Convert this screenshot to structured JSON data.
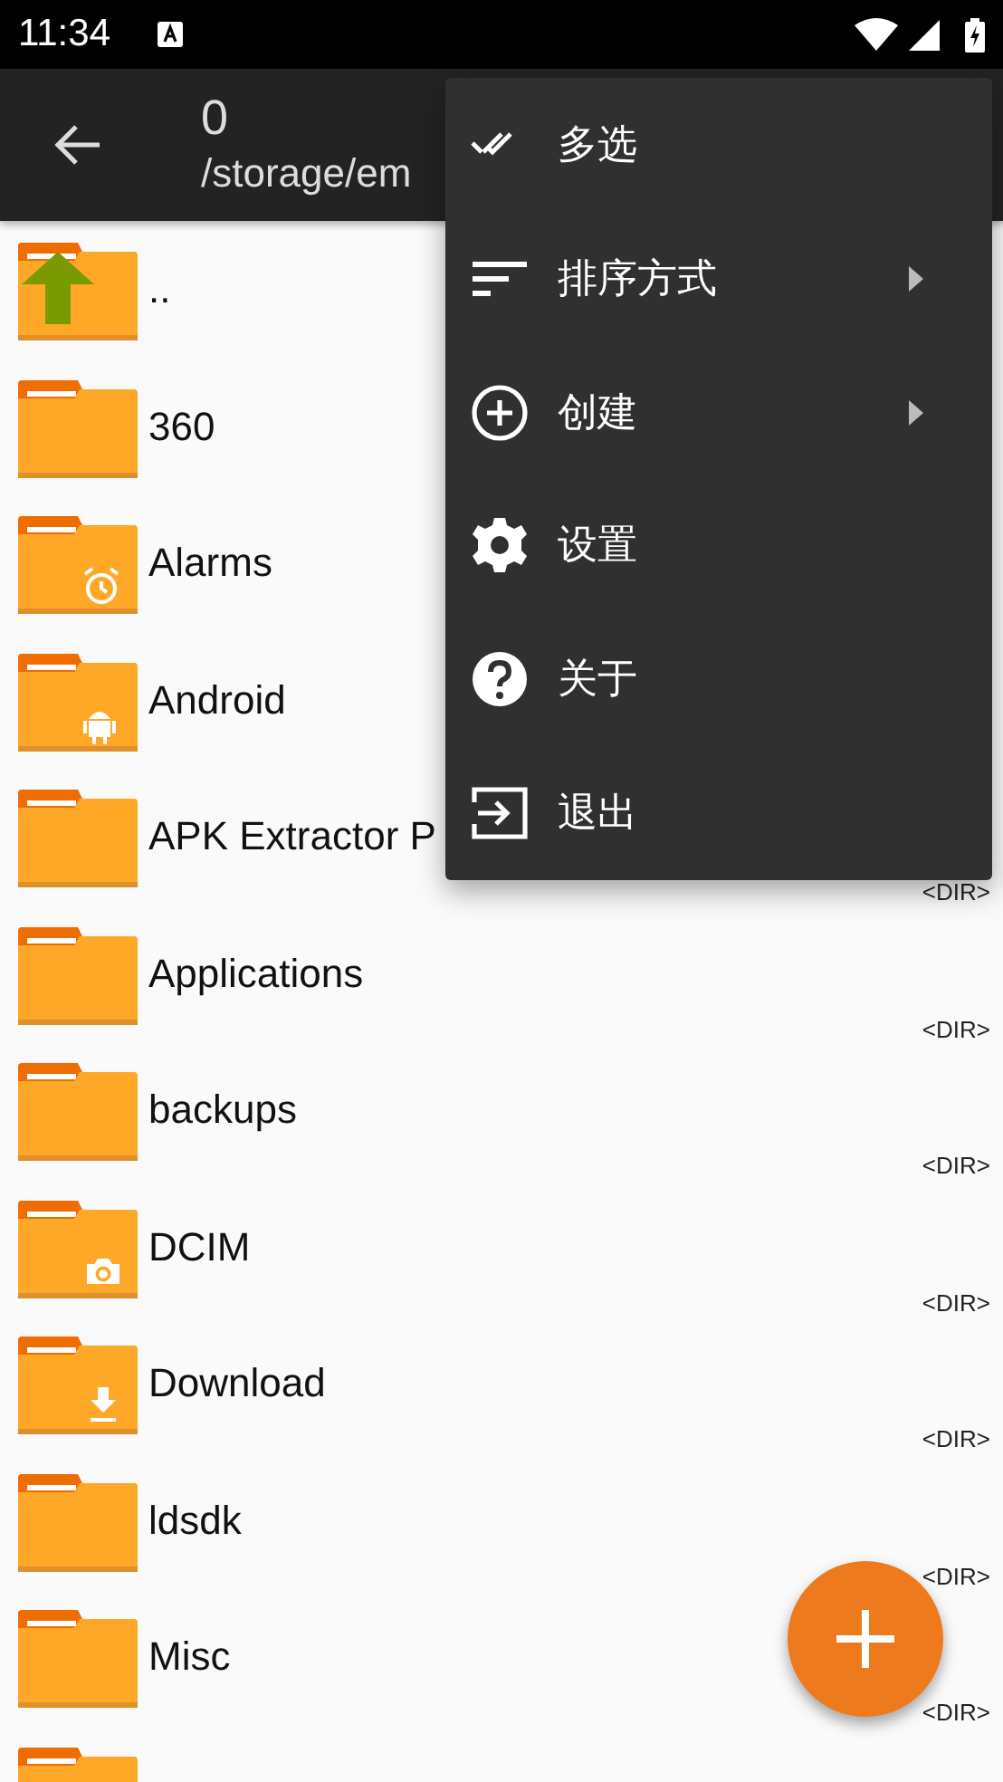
{
  "status_bar": {
    "time": "11:34"
  },
  "toolbar": {
    "title": "0",
    "path": "/storage/em"
  },
  "files": [
    {
      "name": "..",
      "kind": "up"
    },
    {
      "name": "360",
      "kind": "plain"
    },
    {
      "name": "Alarms",
      "kind": "alarm"
    },
    {
      "name": "Android",
      "kind": "android"
    },
    {
      "name": "APK Extractor P",
      "kind": "plain",
      "type": "<DIR>"
    },
    {
      "name": "Applications",
      "kind": "plain",
      "type": "<DIR>"
    },
    {
      "name": "backups",
      "kind": "plain",
      "type": "<DIR>"
    },
    {
      "name": "DCIM",
      "kind": "camera",
      "type": "<DIR>"
    },
    {
      "name": "Download",
      "kind": "download",
      "type": "<DIR>"
    },
    {
      "name": "ldsdk",
      "kind": "plain",
      "type": "<DIR>"
    },
    {
      "name": "Misc",
      "kind": "plain",
      "type": "<DIR>"
    },
    {
      "kind": "plain"
    }
  ],
  "menu": [
    {
      "label": "多选",
      "kind": "multiselect",
      "submenu": false
    },
    {
      "label": "排序方式",
      "kind": "sort",
      "submenu": true
    },
    {
      "label": "创建",
      "kind": "create",
      "submenu": true
    },
    {
      "label": "设置",
      "kind": "settings",
      "submenu": false
    },
    {
      "label": "关于",
      "kind": "help",
      "submenu": false
    },
    {
      "label": "退出",
      "kind": "exit",
      "submenu": false
    }
  ]
}
